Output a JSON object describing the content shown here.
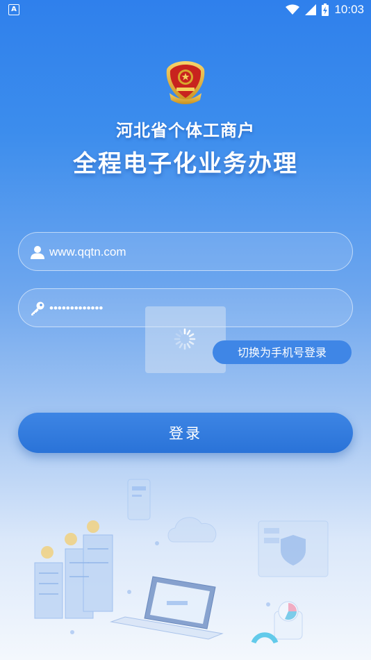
{
  "status_bar": {
    "left_icon_letter": "A",
    "time": "10:03",
    "icons": [
      "wifi-icon",
      "cell-signal-icon",
      "battery-charging-icon"
    ]
  },
  "header": {
    "emblem_icon": "national-emblem-icon",
    "title_line1": "河北省个体工商户",
    "title_line2": "全程电子化业务办理"
  },
  "login_form": {
    "username": {
      "icon": "user-icon",
      "value": "www.qqtn.com",
      "placeholder": ""
    },
    "password": {
      "icon": "key-icon",
      "value": "•••••••••••••",
      "placeholder": ""
    },
    "switch_label": "切换为手机号登录",
    "submit_label": "登录"
  },
  "loading_indicator": {
    "icon": "spinner-icon"
  },
  "colors": {
    "bg_top": "#2f80ec",
    "bg_bottom": "#f4f8fd",
    "button": "#2a73d8",
    "switch_button": "#3f86e6"
  }
}
